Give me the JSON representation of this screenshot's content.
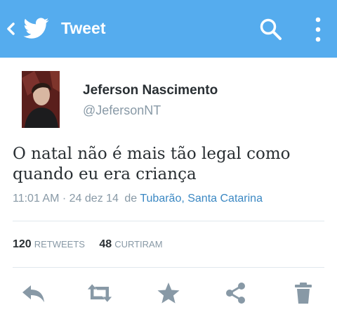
{
  "header": {
    "title": "Tweet"
  },
  "tweet": {
    "author_name": "Jeferson Nascimento",
    "author_handle": "@JefersonNT",
    "text": "O natal não é mais tão legal como quando eu era criança",
    "time": "11:01 AM",
    "separator": "·",
    "date": "24 dez 14",
    "from_label": "de",
    "location": "Tubarão, Santa Catarina"
  },
  "stats": {
    "retweets_count": "120",
    "retweets_label": "RETWEETS",
    "likes_count": "48",
    "likes_label": "CURTIRAM"
  },
  "colors": {
    "header_bg": "#55acee",
    "link": "#3b88c3",
    "icon_gray": "#8899a6",
    "text": "#292f33"
  },
  "icons": {
    "back": "chevron-left-icon",
    "logo": "twitter-bird-icon",
    "search": "search-icon",
    "menu": "more-vertical-icon",
    "reply": "reply-icon",
    "retweet": "retweet-icon",
    "favorite": "star-icon",
    "share": "share-icon",
    "delete": "trash-icon"
  }
}
